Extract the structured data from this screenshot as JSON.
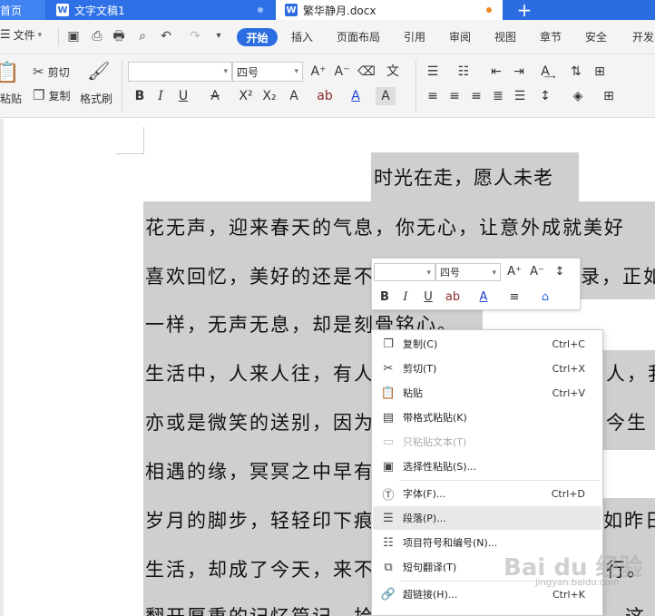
{
  "tabs": {
    "home": "首页",
    "doc1": "文字文稿1",
    "doc2": "繁华静月.docx",
    "add": "+",
    "doc_icon_letter": "W"
  },
  "menubar": {
    "file": "文件",
    "start": "开始",
    "items": [
      "插入",
      "页面布局",
      "引用",
      "审阅",
      "视图",
      "章节",
      "安全",
      "开发"
    ]
  },
  "ribbon": {
    "paste": "粘贴",
    "cut": "剪切",
    "copy": "复制",
    "format_painter": "格式刷",
    "font_name": "",
    "font_size": "四号"
  },
  "document": {
    "title": "时光在走，愿人未老",
    "lines": [
      "花无声，迎来春天的气息，你无心，让意外成就美好",
      "喜欢回忆，美好的还是不",
      "录，正如",
      "一样，无声无息，却是刻骨铭心。",
      "生活中，人来人往，有人",
      "人，我",
      "亦或是微笑的送别，因为",
      "今生",
      "相遇的缘，冥冥之中早有",
      "岁月的脚步，轻轻印下痕",
      "如昨日",
      "生活，却成了今天，来不",
      "行。",
      "翻开厚重的记忆篇记，拾大年轻的事业，方字伸线，这"
    ]
  },
  "mini_toolbar": {
    "font_name": "",
    "font_size": "四号"
  },
  "context_menu": {
    "items": [
      {
        "icon": "copy-icon",
        "label": "复制(C)",
        "shortcut": "Ctrl+C"
      },
      {
        "icon": "scissors-icon",
        "label": "剪切(T)",
        "shortcut": "Ctrl+X"
      },
      {
        "icon": "paste-icon",
        "label": "粘贴",
        "shortcut": "Ctrl+V"
      },
      {
        "icon": "paste-format-icon",
        "label": "带格式粘贴(K)",
        "shortcut": ""
      },
      {
        "icon": "paste-text-icon",
        "label": "只粘贴文本(T)",
        "shortcut": ""
      },
      {
        "icon": "paste-special-icon",
        "label": "选择性粘贴(S)...",
        "shortcut": ""
      },
      {
        "icon": "font-icon",
        "label": "字体(F)...",
        "shortcut": "Ctrl+D"
      },
      {
        "icon": "paragraph-icon",
        "label": "段落(P)...",
        "shortcut": ""
      },
      {
        "icon": "bullets-icon",
        "label": "项目符号和编号(N)...",
        "shortcut": ""
      },
      {
        "icon": "translate-icon",
        "label": "短句翻译(T)",
        "shortcut": ""
      },
      {
        "icon": "link-icon",
        "label": "超链接(H)...",
        "shortcut": "Ctrl+K"
      }
    ]
  },
  "watermark": {
    "text": "Bai du 经验",
    "sub": "jingyan.baidu.com"
  },
  "colors": {
    "accent": "#2b6de0",
    "selection": "#cfcfcf",
    "menu_hover": "#e8e8e8"
  }
}
